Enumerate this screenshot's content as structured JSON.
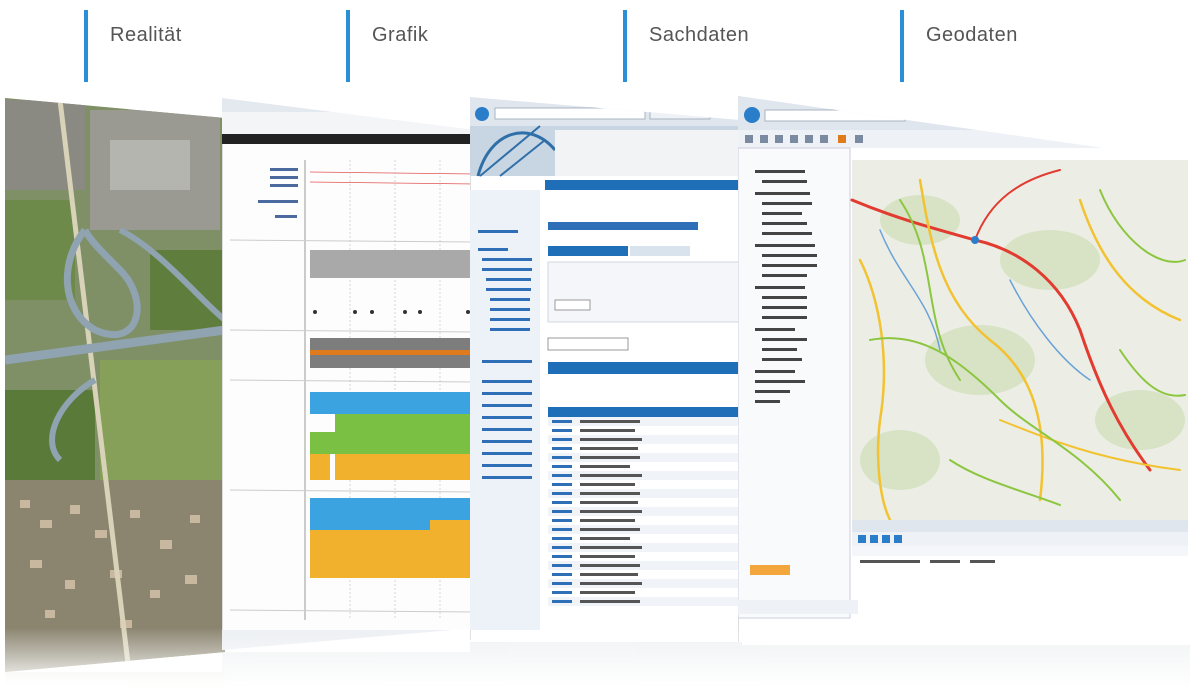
{
  "labels": [
    {
      "text": "Realität"
    },
    {
      "text": "Grafik"
    },
    {
      "text": "Sachdaten"
    },
    {
      "text": "Geodaten"
    }
  ],
  "panels": {
    "aerial": {
      "icon": "aerial-photo"
    },
    "grafik": {
      "icon": "band-chart",
      "colors": [
        "#3aa3e0",
        "#7ac143",
        "#f2b12c",
        "#9e9e9e"
      ]
    },
    "sachdaten": {
      "icon": "data-table",
      "accent": "#1f6fb8"
    },
    "geodaten": {
      "icon": "road-map",
      "road_colors": [
        "#e23b2f",
        "#f2c230",
        "#8cc63f"
      ]
    }
  },
  "colors": {
    "accent_bar": "#2a8fd6",
    "label_text": "#555555"
  }
}
